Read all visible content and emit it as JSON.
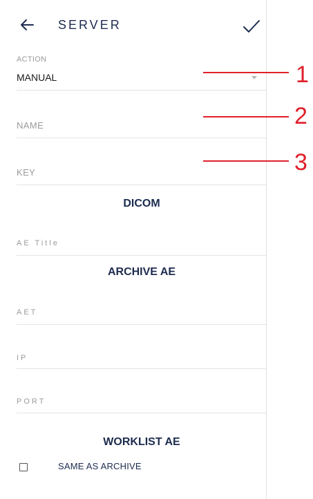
{
  "header": {
    "back_icon": "arrow-left-icon",
    "title": "SERVER",
    "confirm_icon": "checkmark-icon"
  },
  "fields": {
    "action": {
      "label": "ACTION",
      "value": "MANUAL",
      "dropdown_icon": "chevron-down-icon"
    },
    "name": {
      "placeholder": "NAME"
    },
    "key": {
      "placeholder": "KEY"
    }
  },
  "sections": {
    "dicom": {
      "heading": "DICOM",
      "ae_title_placeholder": "AE Title"
    },
    "archive_ae": {
      "heading": "ARCHIVE AE",
      "aet_placeholder": "AET",
      "ip_placeholder": "IP",
      "port_placeholder": "PORT"
    },
    "worklist_ae": {
      "heading": "WORKLIST AE",
      "same_as_archive_label": "SAME AS ARCHIVE",
      "same_as_archive_checked": false
    }
  },
  "callouts": [
    "1",
    "2",
    "3"
  ],
  "colors": {
    "heading": "#1d2b4f",
    "callout": "#e0202a",
    "placeholder": "#9a9a9a",
    "divider": "#e4e4e4"
  }
}
